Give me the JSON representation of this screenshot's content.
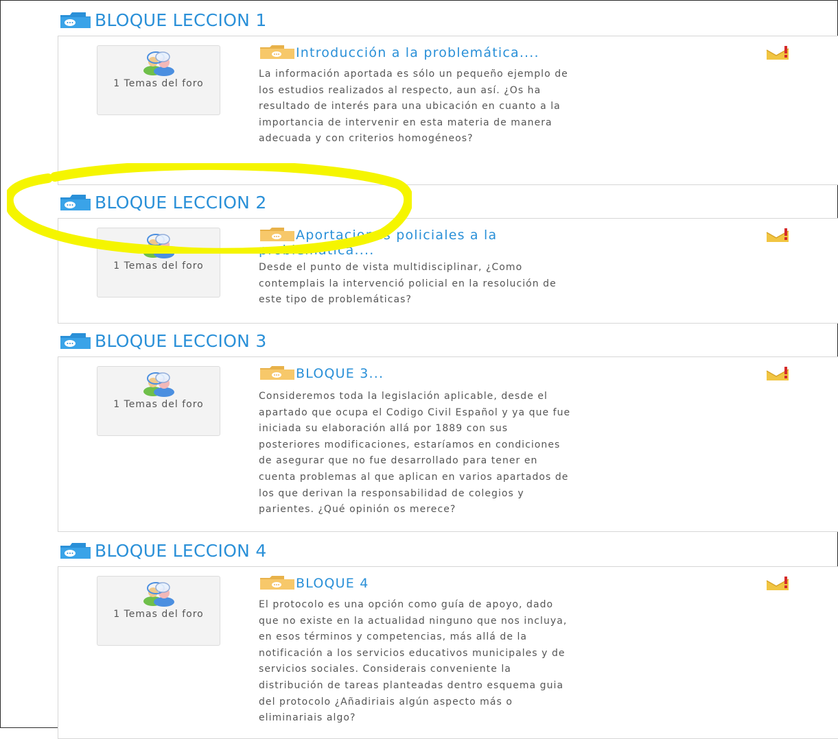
{
  "blocks": [
    {
      "title": "BLOQUE LECCION 1",
      "forum_count": "1 Temas del foro",
      "topic_title": "Introducción a la problemática....",
      "description": "La información aportada es sólo un pequeño ejemplo de\nlos estudios realizados al respecto, aun así. ¿Os ha\nresultado de interés para una ubicación en cuanto a la\nimportancia de intervenir en esta materia de manera\nadecuada y con criterios homogéneos?"
    },
    {
      "title": "BLOQUE LECCION 2",
      "forum_count": "1 Temas del foro",
      "topic_title": "Aportaciones policiales a la problemática....",
      "description": "Desde el punto de vista multidisciplinar, ¿Como\ncontemplais la intervenció policial en la resolución de\neste tipo de problemáticas?"
    },
    {
      "title": "BLOQUE LECCION 3",
      "forum_count": "1 Temas del foro",
      "topic_title": "BLOQUE 3...",
      "description": "Consideremos toda la legislación aplicable, desde el\napartado que ocupa el Codigo Civil Español y ya que fue\n iniciada su elaboración allá por 1889 con  sus\nposteriores modificaciones, estaríamos en condiciones\nde asegurar que no fue desarrollado para tener en\ncuenta problemas al que aplican en varios apartados de\nlos que derivan la responsabilidad de colegios y\nparientes. ¿Qué opinión os merece?"
    },
    {
      "title": "BLOQUE LECCION 4",
      "forum_count": "1 Temas del foro",
      "topic_title": "BLOQUE 4",
      "description": "El protocolo es una opción como guía de apoyo, dado\nque no existe en la actualidad ninguno que nos incluya,\nen esos términos y competencias, más allá de la\nnotificación a los servicios educativos municipales y de\nservicios sociales. Considerais conveniente la\ndistribución de tareas planteadas dentro esquema guia\ndel protocolo ¿Añadiriais algún aspecto más o\neliminariais algo?"
    }
  ],
  "icons": {
    "block": "forum-folder-icon",
    "topic": "folder-icon",
    "forum": "users-icon",
    "subscribe": "mail-flag-icon"
  },
  "colors": {
    "accent": "#2a90d8",
    "highlight": "#f5f500",
    "text": "#555555"
  }
}
